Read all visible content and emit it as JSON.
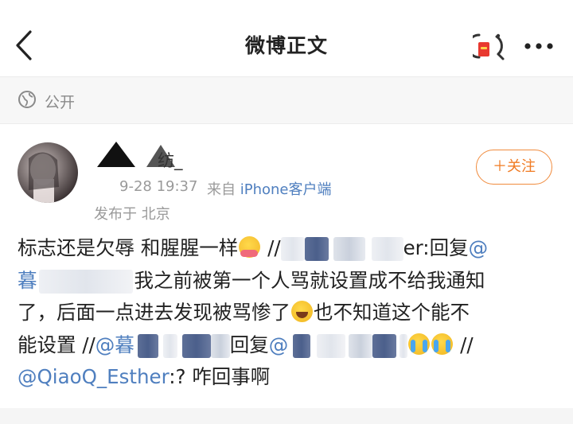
{
  "header": {
    "title": "微博正文"
  },
  "visibility": {
    "label": "公开"
  },
  "author": {
    "name_suffix": "纺_",
    "time_partial": "9-28 19:37",
    "source_prefix": "来自",
    "source_app": "iPhone客户端",
    "location": "发布于 北京",
    "follow_label": "＋关注"
  },
  "post": {
    "l1_text": "标志还是欠辱 和腥腥一样",
    "l1_sep": " //",
    "l1_tail": "er:回复",
    "l1_at": "@",
    "l2_at": "暮",
    "l2_text": "我之前被第一个人骂就设置成不给我通知",
    "l3_text": "了，后面一点进去发现被骂惨了",
    "l3_text2": "也不知道这个能不",
    "l4_text": "能设置 //",
    "l4_at": "@暮",
    "l4_reply": "回复",
    "l4_at2": "@",
    "l4_sep": " //",
    "l5_at": "@QiaoQ_Esther",
    "l5_text": ":? 咋回事啊"
  },
  "icons": {
    "back": "chevron-left-icon",
    "hongbao": "red-envelope-icon",
    "more": "more-icon",
    "globe": "globe-icon"
  },
  "colors": {
    "link": "#4f7fbf",
    "follow": "#f07a22",
    "meta": "#9a9a9a"
  }
}
